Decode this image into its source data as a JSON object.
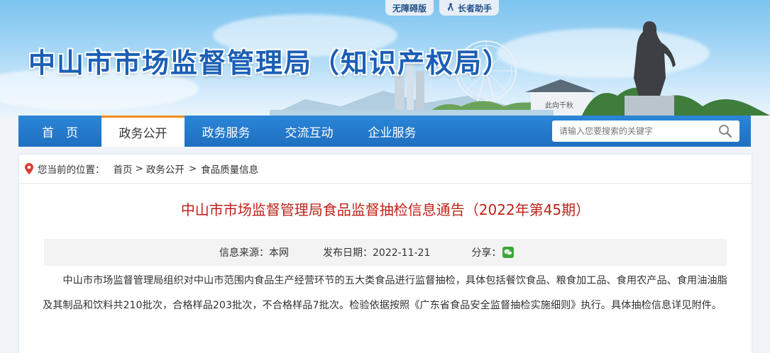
{
  "top_buttons": {
    "accessibility": "无障碍版",
    "elderly": "长者助手"
  },
  "site": {
    "title": "中山市市场监督管理局（知识产权局）"
  },
  "nav": {
    "items": [
      {
        "label": "首　页"
      },
      {
        "label": "政务公开"
      },
      {
        "label": "政务服务"
      },
      {
        "label": "交流互动"
      },
      {
        "label": "企业服务"
      }
    ],
    "active_index": 1,
    "search_placeholder": "请输入您要搜索的关键字"
  },
  "breadcrumb": {
    "prefix": "您当前的位置：",
    "items": [
      "首页",
      "政务公开",
      "食品质量信息"
    ]
  },
  "article": {
    "title": "中山市市场监督管理局食品监督抽检信息通告（2022年第45期）",
    "source_label": "信息来源：本网",
    "date_label": "发布日期：2022-11-21",
    "share_label": "分享：",
    "body": "中山市市场监督管理局组织对中山市范围内食品生产经营环节的五大类食品进行监督抽检，具体包括餐饮食品、粮食加工品、食用农产品、食用油油脂及其制品和饮料共210批次，合格样品203批次，不合格样品7批次。检验依据按照《广东省食品安全监督抽检实施细则》执行。具体抽检信息详见附件。"
  },
  "colors": {
    "nav_blue": "#1f6fc0",
    "title_red": "#c0211a",
    "active_tab_border": "#f08a1d",
    "site_title_blue": "#1b5fb5"
  }
}
